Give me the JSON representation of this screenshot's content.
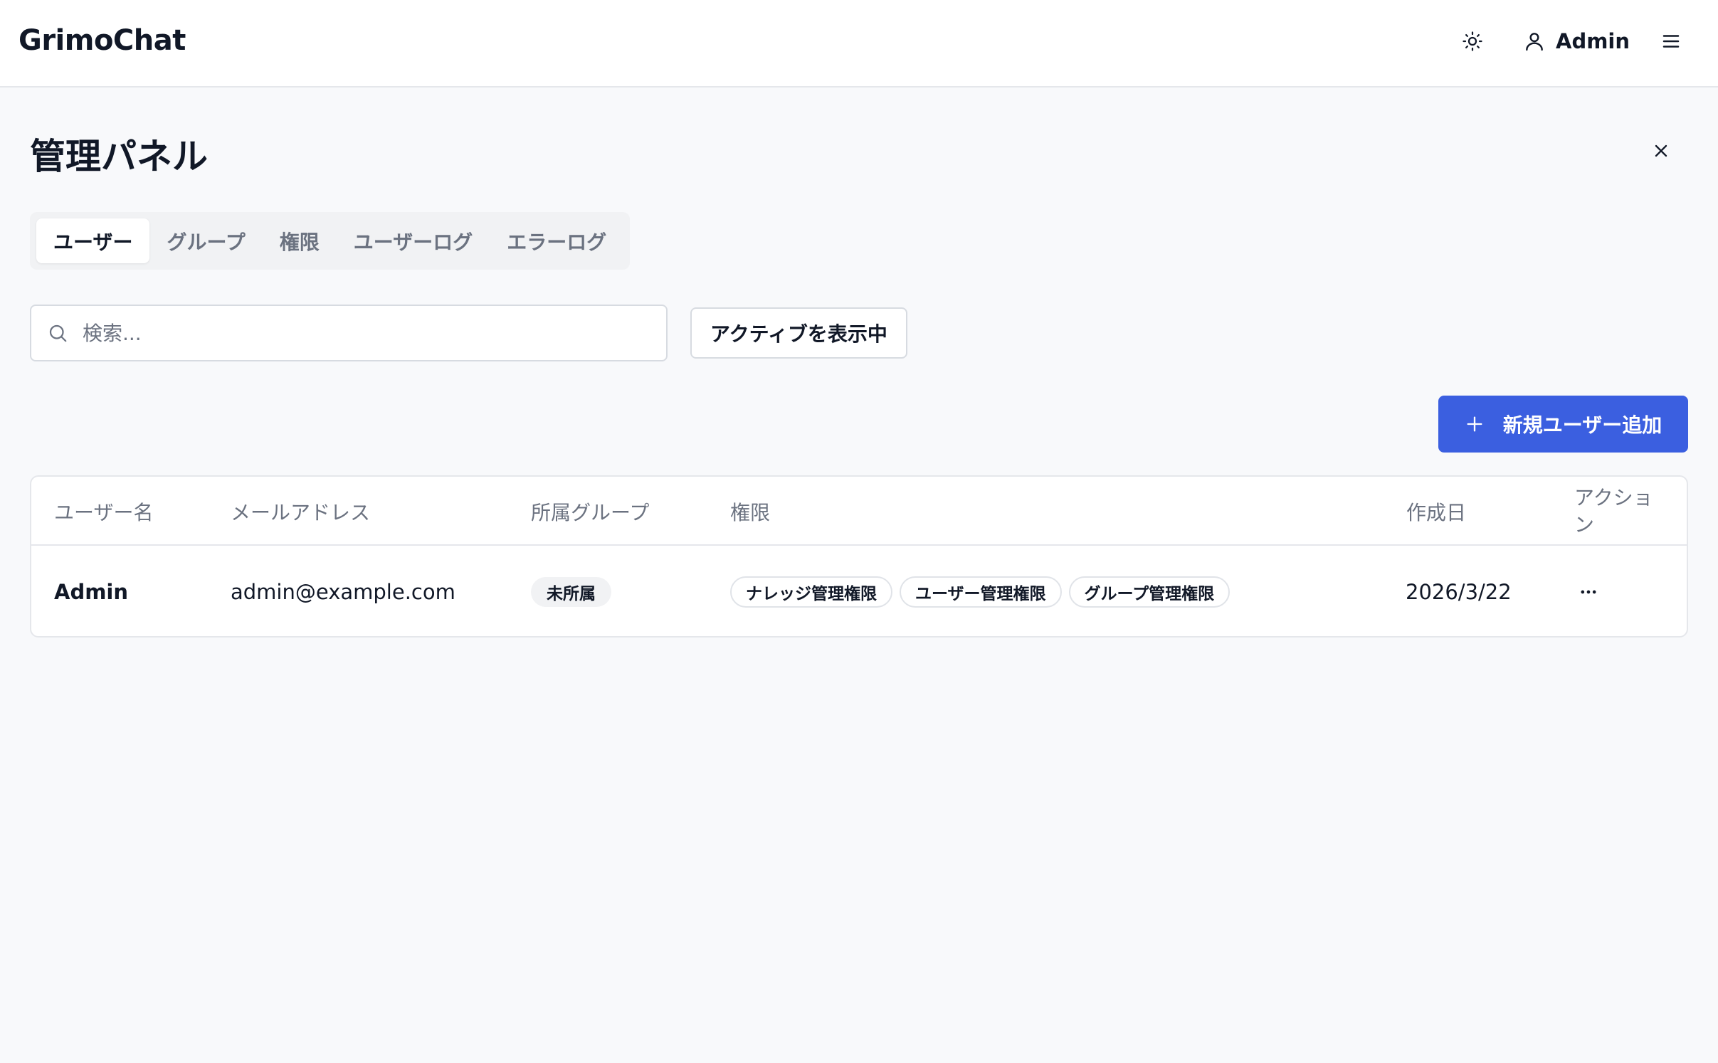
{
  "app": {
    "title": "GrimoChat"
  },
  "header": {
    "theme_icon": "sun-icon",
    "user_icon": "user-icon",
    "user_label": "Admin",
    "menu_icon": "hamburger-menu-icon"
  },
  "panel": {
    "title": "管理パネル",
    "close_icon": "close-icon"
  },
  "tabs": [
    {
      "label": "ユーザー",
      "active": true
    },
    {
      "label": "グループ",
      "active": false
    },
    {
      "label": "権限",
      "active": false
    },
    {
      "label": "ユーザーログ",
      "active": false
    },
    {
      "label": "エラーログ",
      "active": false
    }
  ],
  "search": {
    "placeholder": "検索...",
    "value": "",
    "icon": "search-icon"
  },
  "filter": {
    "active_toggle_label": "アクティブを表示中"
  },
  "add_user": {
    "label": "新規ユーザー追加",
    "icon": "plus-icon"
  },
  "table": {
    "headers": {
      "username": "ユーザー名",
      "email": "メールアドレス",
      "group": "所属グループ",
      "permissions": "権限",
      "created": "作成日",
      "actions": "アクション"
    },
    "rows": [
      {
        "username": "Admin",
        "email": "admin@example.com",
        "group": "未所属",
        "permissions": [
          "ナレッジ管理権限",
          "ユーザー管理権限",
          "グループ管理権限"
        ],
        "created": "2026/3/22",
        "actions_icon": "more-horizontal-icon"
      }
    ]
  },
  "colors": {
    "accent": "#3b5fe0",
    "background": "#f8f9fb",
    "border": "#e5e7eb",
    "muted_text": "#6b7280"
  }
}
